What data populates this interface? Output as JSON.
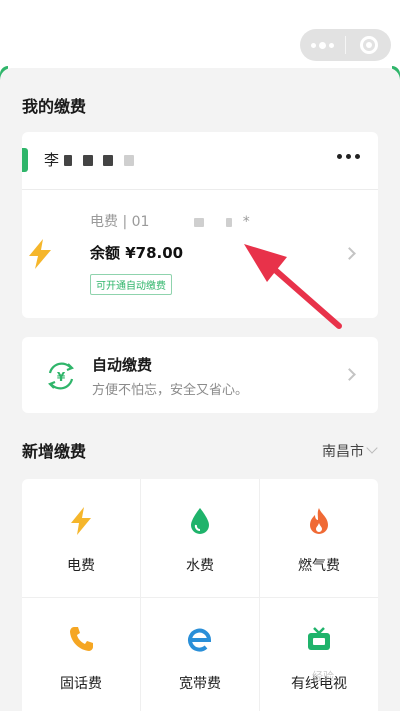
{
  "header": {
    "more_icon": "more-dots-icon",
    "close_icon": "target-circle-icon"
  },
  "my_payments": {
    "title": "我的缴费",
    "account": {
      "name": "李",
      "bill_type_label": "电费 | 01",
      "bill_suffix": "*",
      "balance": "余额 ¥78.00",
      "auto_tag": "可开通自动缴费",
      "icon": "lightning-icon"
    },
    "auto_pay": {
      "title": "自动缴费",
      "subtitle": "方便不怕忘，安全又省心。",
      "icon": "auto-yuan-icon"
    }
  },
  "new_payment": {
    "title": "新增缴费",
    "city": "南昌市",
    "items": [
      {
        "label": "电费",
        "icon": "lightning-icon"
      },
      {
        "label": "水费",
        "icon": "water-drop-icon"
      },
      {
        "label": "燃气费",
        "icon": "flame-icon"
      },
      {
        "label": "固话费",
        "icon": "phone-icon"
      },
      {
        "label": "宽带费",
        "icon": "broadband-e-icon"
      },
      {
        "label": "有线电视",
        "icon": "tv-icon"
      }
    ]
  },
  "watermark": "经验",
  "colors": {
    "accent_green": "#2fb56a",
    "lightning_yellow": "#f5b62b",
    "water_green": "#1fb36b",
    "flame_orange": "#f06a35",
    "phone_orange": "#f5a623",
    "broadband_blue": "#2a8fd8",
    "arrow_red": "#e8324a"
  }
}
